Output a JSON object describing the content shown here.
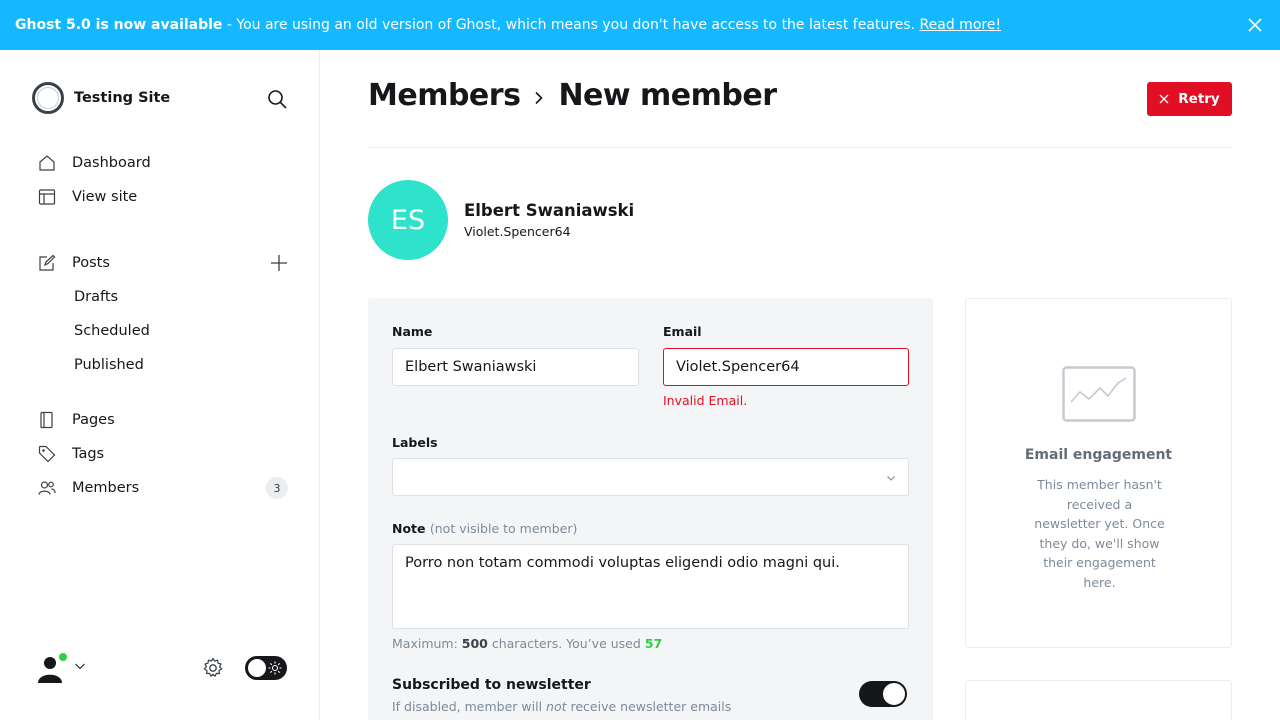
{
  "banner": {
    "bold": "Ghost 5.0 is now available",
    "text": " - You are using an old version of Ghost, which means you don't have access to the latest features. ",
    "link": "Read more!"
  },
  "sidebar": {
    "site_name": "Testing Site",
    "nav_main": [
      {
        "label": "Dashboard",
        "icon": "home-icon"
      },
      {
        "label": "View site",
        "icon": "layout-icon"
      }
    ],
    "posts": {
      "label": "Posts",
      "sub": [
        "Drafts",
        "Scheduled",
        "Published"
      ]
    },
    "nav_more": [
      {
        "label": "Pages",
        "icon": "page-icon"
      },
      {
        "label": "Tags",
        "icon": "tag-icon"
      },
      {
        "label": "Members",
        "icon": "members-icon",
        "count": "3"
      }
    ]
  },
  "header": {
    "crumb": "Members",
    "title": "New member",
    "retry_label": "Retry"
  },
  "member": {
    "initials": "ES",
    "name": "Elbert Swaniawski",
    "email": "Violet.Spencer64",
    "avatar_color": "#2ee2cc"
  },
  "form": {
    "name_label": "Name",
    "name_value": "Elbert Swaniawski",
    "email_label": "Email",
    "email_value": "Violet.Spencer64",
    "email_error": "Invalid Email.",
    "labels_label": "Labels",
    "note_label": "Note",
    "note_hint": "(not visible to member)",
    "note_value": "Porro non totam commodi voluptas eligendi odio magni qui.",
    "counter_prefix": "Maximum: ",
    "counter_max": "500",
    "counter_mid": " characters. You’ve used ",
    "counter_used": "57",
    "newsletter_title": "Subscribed to newsletter",
    "newsletter_help_a": "If disabled, member will ",
    "newsletter_help_em": "not",
    "newsletter_help_b": " receive newsletter emails",
    "newsletter_on": true
  },
  "engagement": {
    "title": "Email engagement",
    "text": "This member hasn't received a newsletter yet. Once they do, we'll show their engagement here."
  },
  "colors": {
    "banner": "#14b8ff",
    "danger": "#e10e24",
    "success": "#30cf43"
  }
}
